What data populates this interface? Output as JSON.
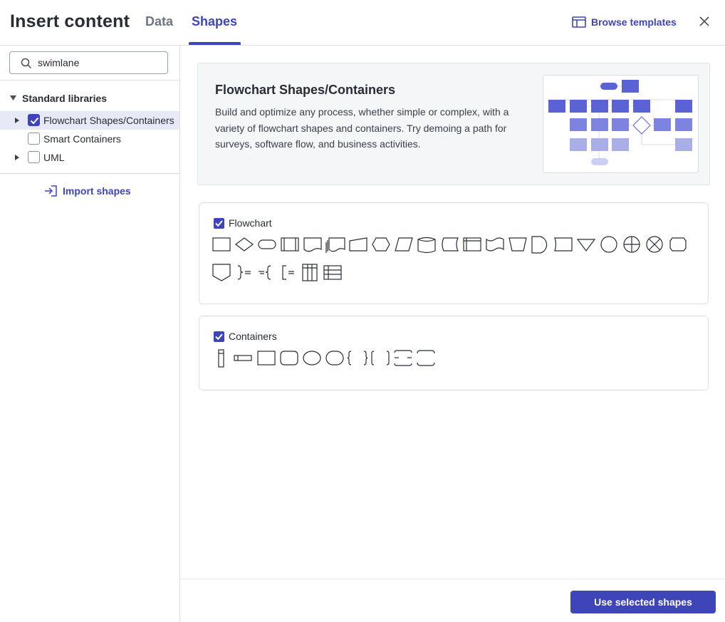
{
  "header": {
    "title": "Insert content",
    "tabs": [
      {
        "label": "Data",
        "active": false
      },
      {
        "label": "Shapes",
        "active": true
      }
    ],
    "browse_label": "Browse templates",
    "browse_icon": "template-icon",
    "close_icon": "close-icon"
  },
  "sidebar": {
    "search": {
      "value": "swimlane",
      "placeholder": "Search shapes"
    },
    "section_label": "Standard libraries",
    "items": [
      {
        "label": "Flowchart Shapes/Containers",
        "checked": true,
        "selected": true,
        "expandable": true
      },
      {
        "label": "Smart Containers",
        "checked": false,
        "selected": false,
        "expandable": false
      },
      {
        "label": "UML",
        "checked": false,
        "selected": false,
        "expandable": true
      }
    ],
    "import_label": "Import shapes"
  },
  "info": {
    "title": "Flowchart Shapes/Containers",
    "description": "Build and optimize any process, whether simple or complex, with a variety of flowchart shapes and containers. Try demoing a path for surveys, software flow, and business activities."
  },
  "groups": [
    {
      "label": "Flowchart",
      "checked": true
    },
    {
      "label": "Containers",
      "checked": true
    }
  ],
  "footer": {
    "button_label": "Use selected shapes"
  },
  "colors": {
    "accent": "#3e45b8",
    "border": "#dcdfe4",
    "selected_row": "#e8e9f7"
  }
}
